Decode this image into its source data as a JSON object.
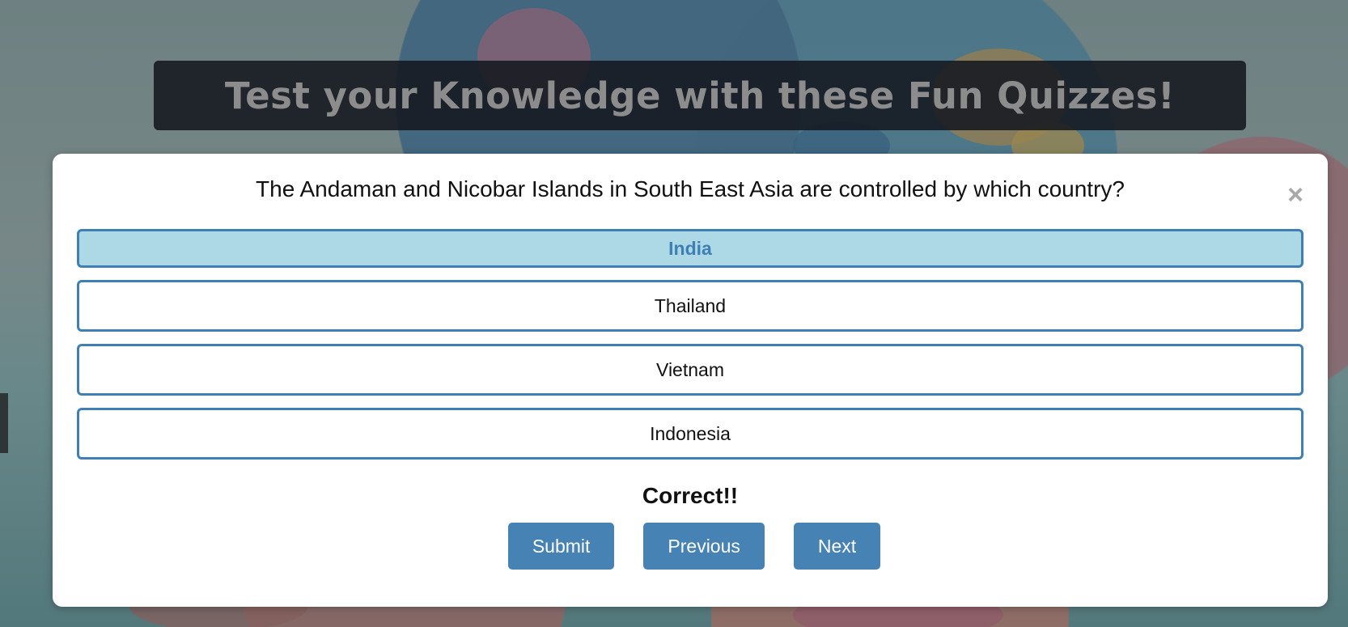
{
  "header": {
    "title": "Test your Knowledge with these Fun Quizzes!"
  },
  "quiz": {
    "question": "The Andaman and Nicobar Islands in South East Asia are controlled by which country?",
    "close_label": "×",
    "options": [
      {
        "label": "India",
        "selected": true
      },
      {
        "label": "Thailand",
        "selected": false
      },
      {
        "label": "Vietnam",
        "selected": false
      },
      {
        "label": "Indonesia",
        "selected": false
      }
    ],
    "feedback": "Correct!!",
    "buttons": {
      "submit": "Submit",
      "previous": "Previous",
      "next": "Next"
    }
  },
  "colors": {
    "accent": "#4682b4",
    "selected_bg": "#add8e6",
    "option_border": "#3f7fb5"
  }
}
